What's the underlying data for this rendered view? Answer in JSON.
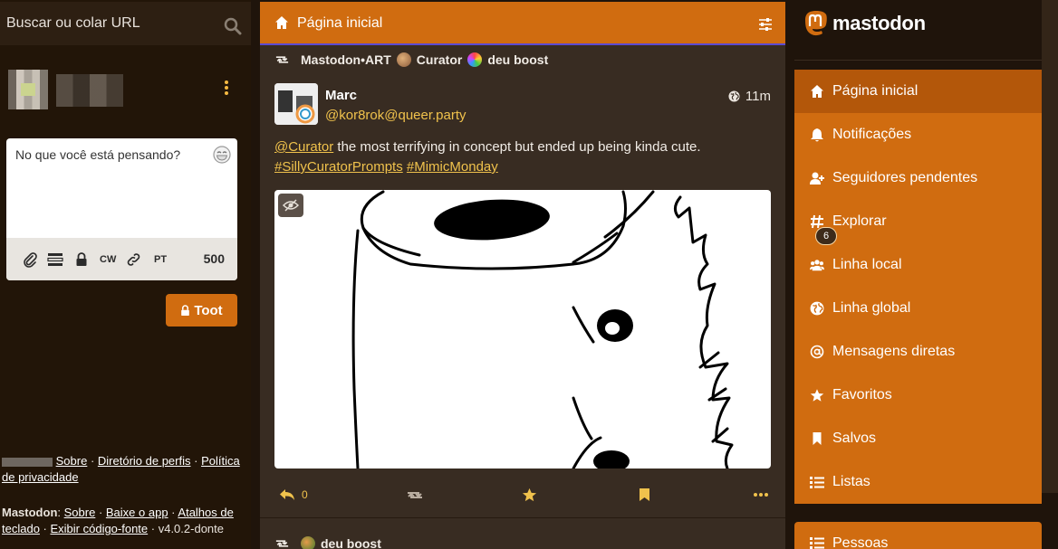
{
  "search": {
    "placeholder": "Buscar ou colar URL"
  },
  "compose": {
    "placeholder": "No que você está pensando?",
    "cw_label": "CW",
    "lang_label": "PT",
    "char_count": "500",
    "toot_label": "Toot"
  },
  "footer": {
    "about": "Sobre",
    "directory": "Diretório de perfis",
    "privacy": "Política de privacidade",
    "mastodon_label": "Mastodon",
    "about2": "Sobre",
    "get_app": "Baixe o app",
    "shortcuts": "Atalhos de teclado",
    "source": "Exibir código-fonte",
    "version": "v4.0.2-donte"
  },
  "column": {
    "title": "Página inicial"
  },
  "post": {
    "boost_by": "Mastodon•ART",
    "boost_curator": "Curator",
    "boost_suffix": "deu boost",
    "author_name": "Marc",
    "author_handle": "@kor8rok@queer.party",
    "time": "11m",
    "mention": "@Curator",
    "text": " the most terrifying in concept but ended up being kinda cute.",
    "tag1": "#SillyCuratorPrompts",
    "tag2": "#MimicMonday",
    "reply_count": "0"
  },
  "next_post": {
    "boost_suffix": "deu boost"
  },
  "brand": {
    "name": "mastodon"
  },
  "nav": {
    "items": [
      {
        "label": "Página inicial"
      },
      {
        "label": "Notificações"
      },
      {
        "label": "Seguidores pendentes"
      },
      {
        "label": "Explorar"
      },
      {
        "label": "Linha local"
      },
      {
        "label": "Linha global"
      },
      {
        "label": "Mensagens diretas"
      },
      {
        "label": "Favoritos"
      },
      {
        "label": "Salvos"
      },
      {
        "label": "Listas"
      }
    ],
    "pending_count": "6",
    "people": "Pessoas"
  },
  "colors": {
    "accent": "#d06c10",
    "link": "#f0c24c",
    "background": "#1f140b",
    "column": "#382c22"
  }
}
